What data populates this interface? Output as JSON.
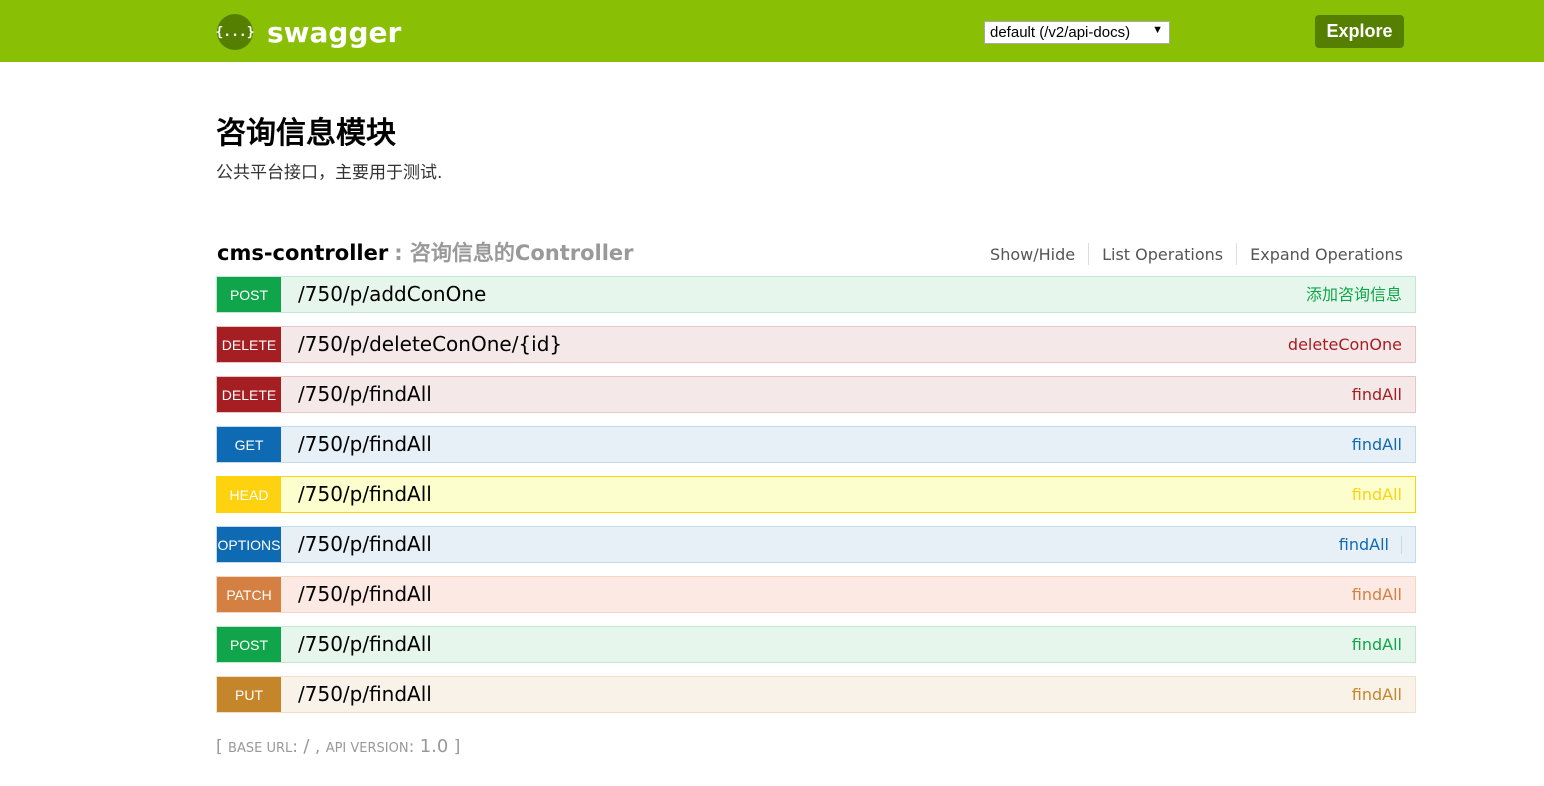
{
  "header": {
    "logo_icon": "{...}",
    "logo_text": "swagger",
    "spec_select_value": "default (/v2/api-docs)",
    "spec_select_arrow": "▼",
    "explore_label": "Explore",
    "colors": {
      "bar": "#89bf04",
      "dark": "#547f00"
    }
  },
  "info": {
    "title": "咨询信息模块",
    "description": "公共平台接口，主要用于测试."
  },
  "resource": {
    "name": "cms-controller",
    "separator": ":",
    "description": "咨询信息的Controller",
    "links": [
      "Show/Hide",
      "List Operations",
      "Expand Operations"
    ]
  },
  "operations": [
    {
      "method": "POST",
      "path": "/750/p/addConOne",
      "summary": "添加咨询信息"
    },
    {
      "method": "DELETE",
      "path": "/750/p/deleteConOne/{id}",
      "summary": "deleteConOne"
    },
    {
      "method": "DELETE",
      "path": "/750/p/findAll",
      "summary": "findAll"
    },
    {
      "method": "GET",
      "path": "/750/p/findAll",
      "summary": "findAll"
    },
    {
      "method": "HEAD",
      "path": "/750/p/findAll",
      "summary": "findAll"
    },
    {
      "method": "OPTIONS",
      "path": "/750/p/findAll",
      "summary": "findAll"
    },
    {
      "method": "PATCH",
      "path": "/750/p/findAll",
      "summary": "findAll"
    },
    {
      "method": "POST",
      "path": "/750/p/findAll",
      "summary": "findAll"
    },
    {
      "method": "PUT",
      "path": "/750/p/findAll",
      "summary": "findAll"
    }
  ],
  "method_colors": {
    "POST": "#10a54a",
    "DELETE": "#a41e22",
    "GET": "#0f6ab4",
    "HEAD": "#ffd20f",
    "OPTIONS": "#0f6ab4",
    "PATCH": "#d38042",
    "PUT": "#c5862b"
  },
  "footer": {
    "open": "[",
    "base_url_label": "BASE URL",
    "base_url_value": "/",
    "api_version_label": "API VERSION",
    "api_version_value": "1.0",
    "close": "]"
  }
}
